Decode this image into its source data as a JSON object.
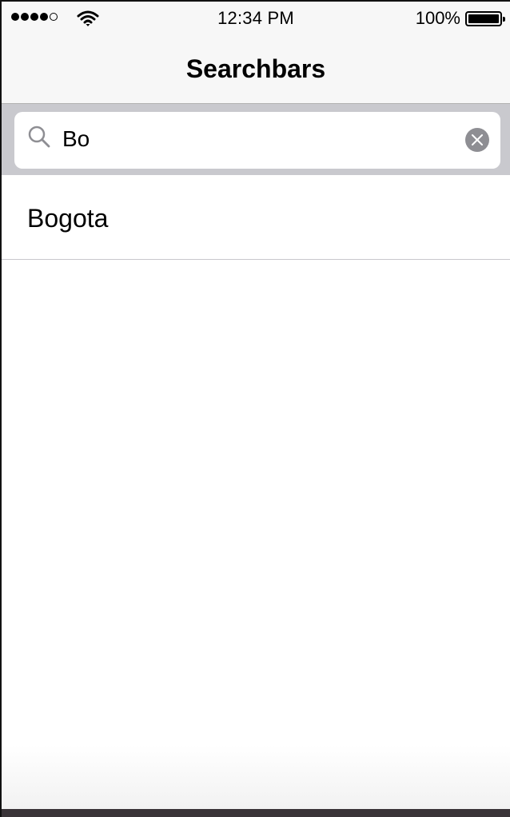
{
  "status_bar": {
    "time": "12:34 PM",
    "battery_percent": "100%",
    "signal_bars_filled": 4,
    "signal_bars_total": 5,
    "icons": [
      "signal-dots-icon",
      "wifi-icon",
      "battery-icon"
    ]
  },
  "nav": {
    "title": "Searchbars"
  },
  "search": {
    "value": "Bo",
    "icon": "search-icon",
    "clear_icon": "clear-icon"
  },
  "results": [
    {
      "label": "Bogota"
    }
  ],
  "colors": {
    "bar_background": "#f7f7f7",
    "search_bar_background": "#c9c9ce",
    "clear_button": "#8e8e93",
    "separator": "#c8c7cc"
  }
}
